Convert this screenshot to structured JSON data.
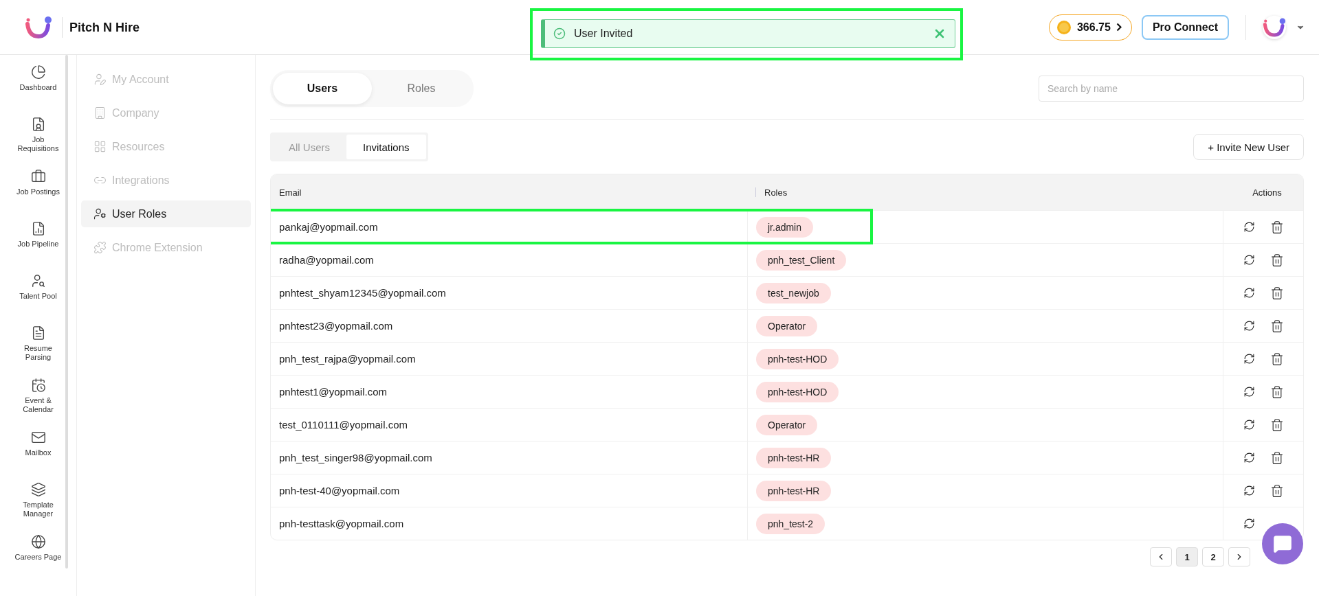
{
  "header": {
    "brand": "Pitch N Hire",
    "credits": "366.75",
    "pro_button": "Pro Connect"
  },
  "toast": {
    "message": "User Invited",
    "highlighted": true
  },
  "nav": [
    {
      "label": "Dashboard",
      "kind": "pie"
    },
    {
      "label": "Job Requisitions",
      "kind": "userdoc"
    },
    {
      "label": "Job Postings",
      "kind": "briefcase"
    },
    {
      "label": "Job Pipeline",
      "kind": "filechart"
    },
    {
      "label": "Talent Pool",
      "kind": "usersearch"
    },
    {
      "label": "Resume Parsing",
      "kind": "resume"
    },
    {
      "label": "Event & Calendar",
      "kind": "calendar"
    },
    {
      "label": "Mailbox",
      "kind": "mail"
    },
    {
      "label": "Template Manager",
      "kind": "layers"
    },
    {
      "label": "Careers Page",
      "kind": "globe"
    }
  ],
  "settings_menu": [
    {
      "label": "My Account",
      "kind": "userpen",
      "selected": false
    },
    {
      "label": "Company",
      "kind": "building",
      "selected": false
    },
    {
      "label": "Resources",
      "kind": "grid",
      "selected": false
    },
    {
      "label": "Integrations",
      "kind": "link",
      "selected": false
    },
    {
      "label": "User Roles",
      "kind": "usercog",
      "selected": true
    },
    {
      "label": "Chrome Extension",
      "kind": "puzzle",
      "selected": false
    }
  ],
  "tabs": [
    {
      "label": "Users",
      "selected": true
    },
    {
      "label": "Roles",
      "selected": false
    }
  ],
  "search": {
    "placeholder": "Search by name"
  },
  "subtabs": [
    {
      "label": "All Users",
      "selected": false
    },
    {
      "label": "Invitations",
      "selected": true
    }
  ],
  "invite_button": "+ Invite New User",
  "table": {
    "columns": [
      "Email",
      "Roles",
      "Actions"
    ],
    "rows": [
      {
        "email": "pankaj@yopmail.com",
        "role": "jr.admin",
        "highlighted": true
      },
      {
        "email": "radha@yopmail.com",
        "role": "pnh_test_Client",
        "highlighted": false
      },
      {
        "email": "pnhtest_shyam12345@yopmail.com",
        "role": "test_newjob",
        "highlighted": false
      },
      {
        "email": "pnhtest23@yopmail.com",
        "role": "Operator",
        "highlighted": false
      },
      {
        "email": "pnh_test_rajpa@yopmail.com",
        "role": "pnh-test-HOD",
        "highlighted": false
      },
      {
        "email": "pnhtest1@yopmail.com",
        "role": "pnh-test-HOD",
        "highlighted": false
      },
      {
        "email": "test_0110111@yopmail.com",
        "role": "Operator",
        "highlighted": false
      },
      {
        "email": "pnh_test_singer98@yopmail.com",
        "role": "pnh-test-HR",
        "highlighted": false
      },
      {
        "email": "pnh-test-40@yopmail.com",
        "role": "pnh-test-HR",
        "highlighted": false
      },
      {
        "email": "pnh-testtask@yopmail.com",
        "role": "pnh_test-2",
        "highlighted": false
      }
    ]
  },
  "pagination": [
    {
      "label": "1",
      "selected": true
    },
    {
      "label": "2",
      "selected": false
    }
  ]
}
